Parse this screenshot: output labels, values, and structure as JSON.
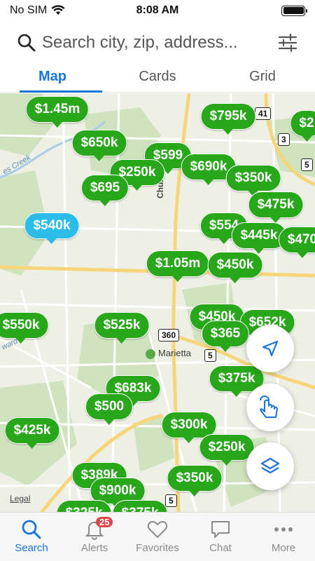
{
  "status_bar": {
    "carrier": "No SIM",
    "time": "8:08 AM",
    "battery_level": 1.0
  },
  "search": {
    "placeholder": "Search city, zip, address..."
  },
  "tabs": [
    {
      "label": "Map",
      "active": true
    },
    {
      "label": "Cards",
      "active": false
    },
    {
      "label": "Grid",
      "active": false
    }
  ],
  "map": {
    "road_label": "Church St N",
    "place_label": "Marietta",
    "creek_label": "es Creek",
    "ward_label": "ward",
    "shields": [
      "41",
      "3",
      "5",
      "360",
      "5",
      "5"
    ],
    "legal": "Legal",
    "pins": [
      "$1.45m",
      "$795k",
      "$2",
      "$650k",
      "$599",
      "$250k",
      "$690k",
      "$695",
      "$350k",
      "$475k",
      "$540k",
      "$554",
      "$445k",
      "$470",
      "$1.05m",
      "$450k",
      "$550k",
      "$525k",
      "$450k",
      "$652k",
      "$365",
      "$683k",
      "$375k",
      "$500",
      "$425k",
      "$300k",
      "$250k",
      "$389k",
      "$350k",
      "$900k",
      "$325k",
      "$375k"
    ],
    "selected_pin": "$540k",
    "colors": {
      "pin": "#29a71a",
      "selected_pin": "#2bbde6",
      "accent": "#1a73d9"
    }
  },
  "fab_icons": [
    "location-arrow-icon",
    "touch-draw-icon",
    "layers-icon"
  ],
  "bottom_nav": {
    "items": [
      {
        "label": "Search",
        "icon": "search-icon",
        "active": true
      },
      {
        "label": "Alerts",
        "icon": "bell-icon",
        "badge": "25"
      },
      {
        "label": "Favorites",
        "icon": "heart-icon"
      },
      {
        "label": "Chat",
        "icon": "chat-icon"
      },
      {
        "label": "More",
        "icon": "more-dots-icon"
      }
    ]
  }
}
